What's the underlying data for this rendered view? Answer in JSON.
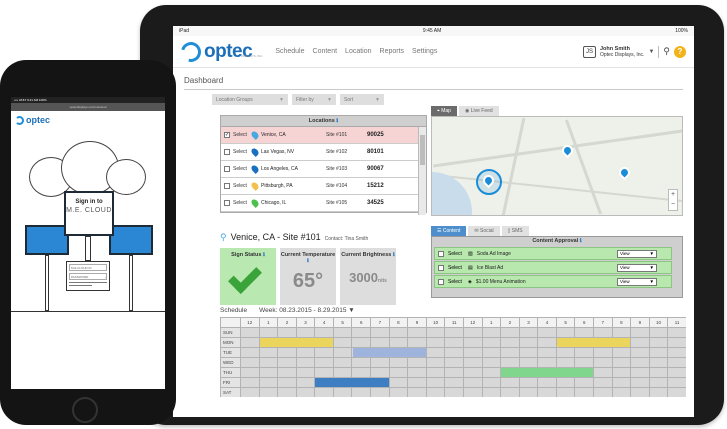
{
  "tablet": {
    "status": {
      "carrier": "iPad",
      "time": "9:45 AM",
      "battery": "100%"
    },
    "logo": {
      "text": "optec",
      "sub": "DISPLAYS, INC."
    },
    "nav": [
      "Schedule",
      "Content",
      "Location",
      "Reports",
      "Settings"
    ],
    "user": {
      "initials": "JS",
      "name": "John Smith",
      "company": "Optec Displays, Inc."
    },
    "dashboard_title": "Dashboard",
    "filters": [
      "Location Groups",
      "Filter by",
      "Sort"
    ],
    "locations": {
      "title": "Locations",
      "select_label": "Select",
      "rows": [
        {
          "city": "Venice, CA",
          "site": "Site #101",
          "zip": "90025",
          "color": "#4aa8e0",
          "selected": true
        },
        {
          "city": "Las Vegas, NV",
          "site": "Site #102",
          "zip": "80101",
          "color": "#1a6fc0",
          "selected": false
        },
        {
          "city": "Los Angeles, CA",
          "site": "Site #103",
          "zip": "90067",
          "color": "#1a6fc0",
          "selected": false
        },
        {
          "city": "Pittsburgh, PA",
          "site": "Site #104",
          "zip": "15212",
          "color": "#f2c14e",
          "selected": false
        },
        {
          "city": "Chicago, IL",
          "site": "Site #105",
          "zip": "34525",
          "color": "#4fbf4f",
          "selected": false
        }
      ]
    },
    "map_tabs": [
      "Map",
      "Live Feed"
    ],
    "site": {
      "title": "Venice, CA - Site #101",
      "contact": "Contact: Tina Smith",
      "cards": [
        {
          "label": "Sign Status",
          "value": ""
        },
        {
          "label": "Current Temperature",
          "value": "65°"
        },
        {
          "label": "Current Brightness",
          "value": "3000",
          "unit": "nits"
        }
      ]
    },
    "content_tabs": [
      "Content",
      "Social",
      "SMS"
    ],
    "approval": {
      "title": "Content Approval",
      "select_label": "Select",
      "rows": [
        {
          "name": "Soda Ad Image",
          "action": "View"
        },
        {
          "name": "Ice Blast Ad",
          "action": "View"
        },
        {
          "name": "$1.00 Menu Animation",
          "action": "View"
        }
      ]
    },
    "schedule": {
      "title": "Schedule",
      "week": "Week: 08.23.2015 - 8.29.2015",
      "hours": [
        "12",
        "1",
        "2",
        "3",
        "4",
        "5",
        "6",
        "7",
        "8",
        "9",
        "10",
        "11",
        "12",
        "1",
        "2",
        "3",
        "4",
        "5",
        "6",
        "7",
        "8",
        "9",
        "10",
        "11"
      ],
      "days": [
        "SUN",
        "MON",
        "TUE",
        "WED",
        "THU",
        "FRI",
        "SAT"
      ],
      "bars": [
        {
          "day": 1,
          "start": 1,
          "end": 5,
          "color": "#ecd55c"
        },
        {
          "day": 1,
          "start": 17,
          "end": 21,
          "color": "#ecd55c"
        },
        {
          "day": 2,
          "start": 6,
          "end": 10,
          "color": "#9fb4dc"
        },
        {
          "day": 4,
          "start": 14,
          "end": 19,
          "color": "#7fd68c"
        },
        {
          "day": 5,
          "start": 4,
          "end": 8,
          "color": "#3d7fc2"
        }
      ]
    }
  },
  "phone": {
    "status": "•••• AT&T     9:41 AM     100%",
    "url": "optecdisplays.com/mecloud",
    "logo": "optec",
    "sign_in_line1": "Sign in to",
    "sign_in_line2": "M.E. CLOUD",
    "username_placeholder": "M.E.CLOUD ID",
    "password_placeholder": "PASSWORD"
  }
}
